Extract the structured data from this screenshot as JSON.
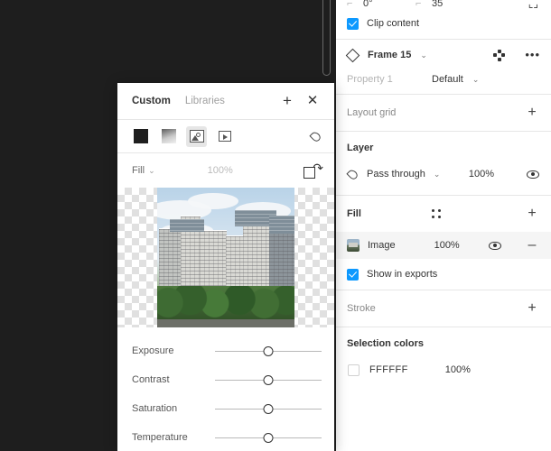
{
  "canvas": {
    "scrollbar": "vertical-scrollbar"
  },
  "inspector": {
    "top_row": {
      "rotation_value": "0°",
      "rotation_icon": "rotation-icon",
      "corner_radius_value": "35",
      "corner_radius_icon": "corner-radius-icon",
      "independent_corners_icon": "independent-corners-icon"
    },
    "clip_content": {
      "label": "Clip content",
      "checked": true
    },
    "component": {
      "name": "Frame 15",
      "icon": "component-diamond-icon",
      "chevron": "chevron-down-icon",
      "swap_icon": "variant-swap-icon",
      "more_icon": "more-options-icon"
    },
    "property": {
      "name": "Property 1",
      "value": "Default"
    },
    "layout_grid": {
      "title": "Layout grid",
      "add": "+"
    },
    "layer": {
      "title": "Layer",
      "blend_mode": "Pass through",
      "opacity": "100%",
      "blend_icon": "blend-mode-icon",
      "visibility_icon": "eye-icon"
    },
    "fill": {
      "title": "Fill",
      "styles_icon": "fill-styles-icon",
      "add": "+",
      "items": [
        {
          "name": "Image",
          "opacity": "100%",
          "visibility_icon": "eye-icon",
          "remove": "–"
        }
      ]
    },
    "show_in_exports": {
      "label": "Show in exports",
      "checked": true
    },
    "stroke": {
      "title": "Stroke",
      "add": "+"
    },
    "selection_colors": {
      "title": "Selection colors",
      "items": [
        {
          "hex": "FFFFFF",
          "opacity": "100%",
          "color": "#FFFFFF"
        }
      ]
    }
  },
  "picker": {
    "tabs": [
      {
        "label": "Custom",
        "active": true
      },
      {
        "label": "Libraries",
        "active": false
      }
    ],
    "add_label": "+",
    "close_label": "✕",
    "fill_types": [
      {
        "name": "solid-fill",
        "selected": false
      },
      {
        "name": "gradient-fill",
        "selected": false
      },
      {
        "name": "image-fill",
        "selected": true
      },
      {
        "name": "video-fill",
        "selected": false
      }
    ],
    "blend_icon": "blend-mode-icon",
    "scale_mode": "Fill",
    "scale_chevron": "chevron-down-icon",
    "opacity": "100%",
    "crop_icon": "crop-rotate-icon",
    "preview": "city-skyline-image",
    "adjustments": [
      {
        "label": "Exposure",
        "value": 50
      },
      {
        "label": "Contrast",
        "value": 50
      },
      {
        "label": "Saturation",
        "value": 50
      },
      {
        "label": "Temperature",
        "value": 50
      }
    ]
  },
  "colors": {
    "accent": "#0D99FF",
    "canvas_bg": "#1E1E1E",
    "panel_bg": "#FFFFFF",
    "selected_row_bg": "#F5F5F5"
  }
}
